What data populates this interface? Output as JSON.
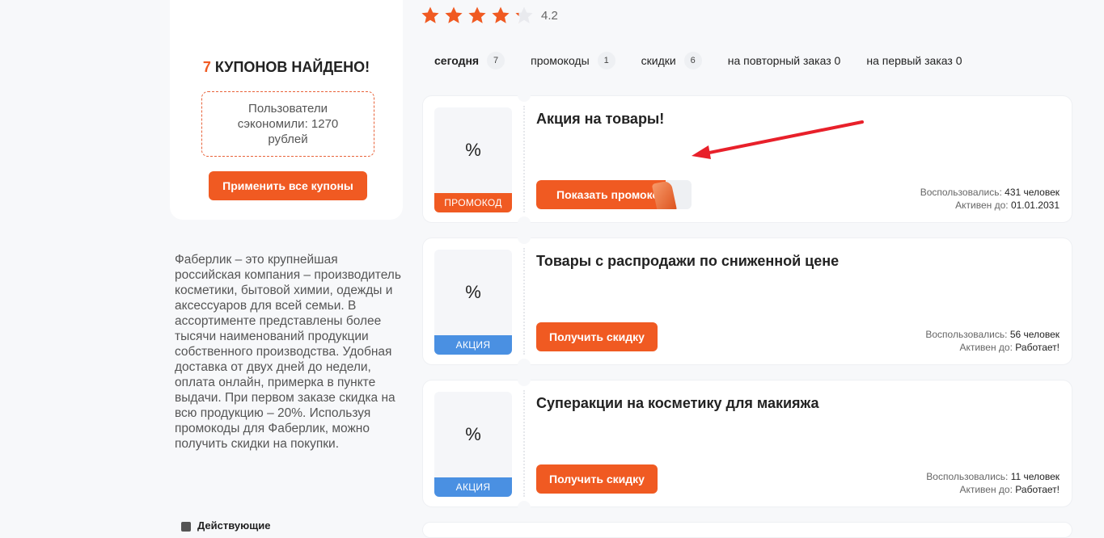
{
  "rating": {
    "value": "4.2",
    "stars": 4.2
  },
  "sidebar": {
    "found_count": "7",
    "found_text": "КУПОНОВ НАЙДЕНО!",
    "saved_text": "Пользователи сэкономили: 1270 рублей",
    "apply_all_label": "Применить все купоны",
    "description": "Фаберлик – это крупнейшая российская компания – производитель косметики, бытовой химии, одежды и аксессуаров для всей семьи. В ассортименте представлены более тысячи наименований продукции собственного производства. Удобная доставка от двух дней до недели, оплата онлайн, примерка в пункте выдачи. При первом заказе скидка на всю продукцию – 20%. Используя промокоды для Фаберлик, можно получить скидки на покупки.",
    "bottom_link": "Действующие"
  },
  "tabs": [
    {
      "label": "сегодня",
      "count": "7"
    },
    {
      "label": "промокоды",
      "count": "1"
    },
    {
      "label": "скидки",
      "count": "6"
    },
    {
      "label": "на повторный заказ 0"
    },
    {
      "label": "на первый заказ 0"
    }
  ],
  "coupons": [
    {
      "pct": "%",
      "tag": "ПРОМОКОД",
      "title": "Акция на товары!",
      "button": "Показать промокод",
      "used_label": "Воспользовались:",
      "used_value": "431 человек",
      "active_label": "Активен до:",
      "active_value": "01.01.2031"
    },
    {
      "pct": "%",
      "tag": "АКЦИЯ",
      "title": "Товары с распродажи по сниженной цене",
      "button": "Получить скидку",
      "used_label": "Воспользовались:",
      "used_value": "56 человек",
      "active_label": "Активен до:",
      "active_value": "Работает!"
    },
    {
      "pct": "%",
      "tag": "АКЦИЯ",
      "title": "Суперакции на косметику для макияжа",
      "button": "Получить скидку",
      "used_label": "Воспользовались:",
      "used_value": "11 человек",
      "active_label": "Активен до:",
      "active_value": "Работает!"
    }
  ],
  "colors": {
    "accent": "#f05a22",
    "sale_tag": "#4a90e2",
    "arrow": "#e8202a"
  }
}
